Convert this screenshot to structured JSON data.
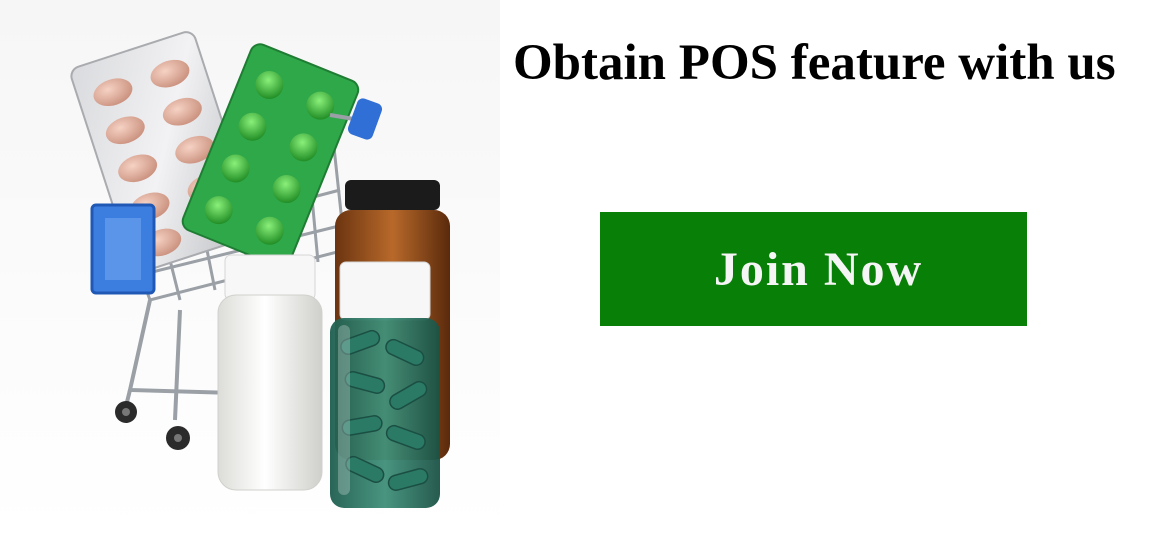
{
  "banner": {
    "headline": "Obtain POS feature with us",
    "cta_label": "Join Now",
    "image_subject": "pharmacy-shopping-cart-with-medicine",
    "colors": {
      "cta_background": "#088008",
      "cta_text": "#f5f5f5",
      "headline_text": "#000000",
      "page_background": "#ffffff"
    }
  }
}
